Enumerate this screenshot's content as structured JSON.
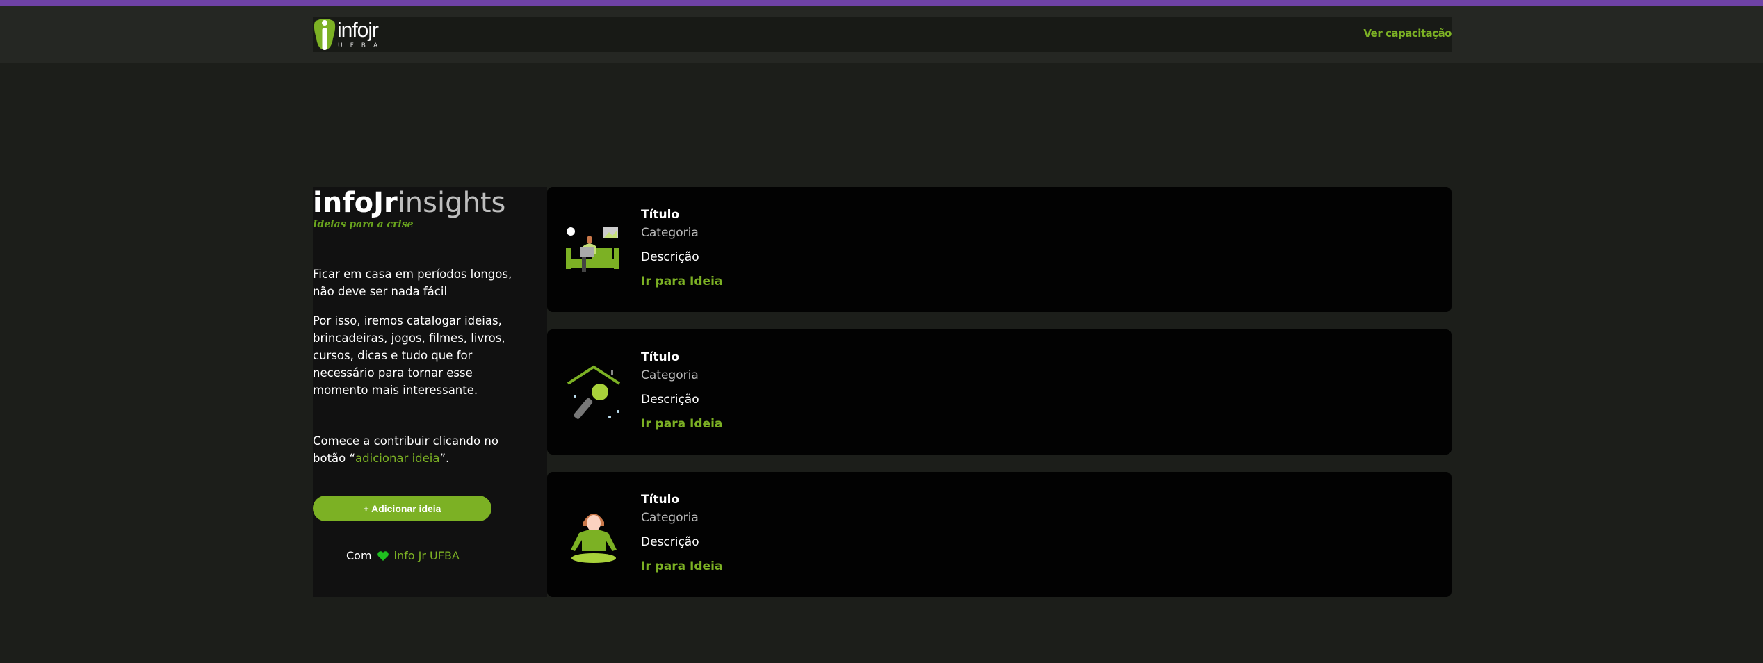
{
  "colors": {
    "accent": "#7cb124",
    "topbar": "#6f42a6",
    "background": "#1c1e1a"
  },
  "header": {
    "logo_text": "infojr",
    "logo_sub": "UFBA",
    "nav_link": "Ver capacitação"
  },
  "sidebar": {
    "brand_bold": "infoJr",
    "brand_light": "insights",
    "tagline": "Ideias para a crise",
    "p1": "Ficar em casa em períodos longos, não deve ser nada fácil",
    "p2": "Por isso, iremos catalogar ideias, brincadeiras, jogos, filmes, livros, cursos, dicas e tudo que for necessário para tornar esse momento mais interessante.",
    "p3_start": "Comece a contribuir clicando no botão “",
    "p3_link": "adicionar ideia",
    "p3_end": "”.",
    "add_button": "+ Adicionar ideia",
    "credit_prefix": "Com",
    "credit_icon": "heart-icon",
    "credit_org": "info Jr UFBA"
  },
  "cards": [
    {
      "icon": "person-on-sofa-laptop-icon",
      "title": "Título",
      "category": "Categoria",
      "description": "Descrição",
      "link": "Ir para Ideia"
    },
    {
      "icon": "house-microphone-icon",
      "title": "Título",
      "category": "Categoria",
      "description": "Descrição",
      "link": "Ir para Ideia"
    },
    {
      "icon": "meditation-person-icon",
      "title": "Título",
      "category": "Categoria",
      "description": "Descrição",
      "link": "Ir para Ideia"
    }
  ]
}
